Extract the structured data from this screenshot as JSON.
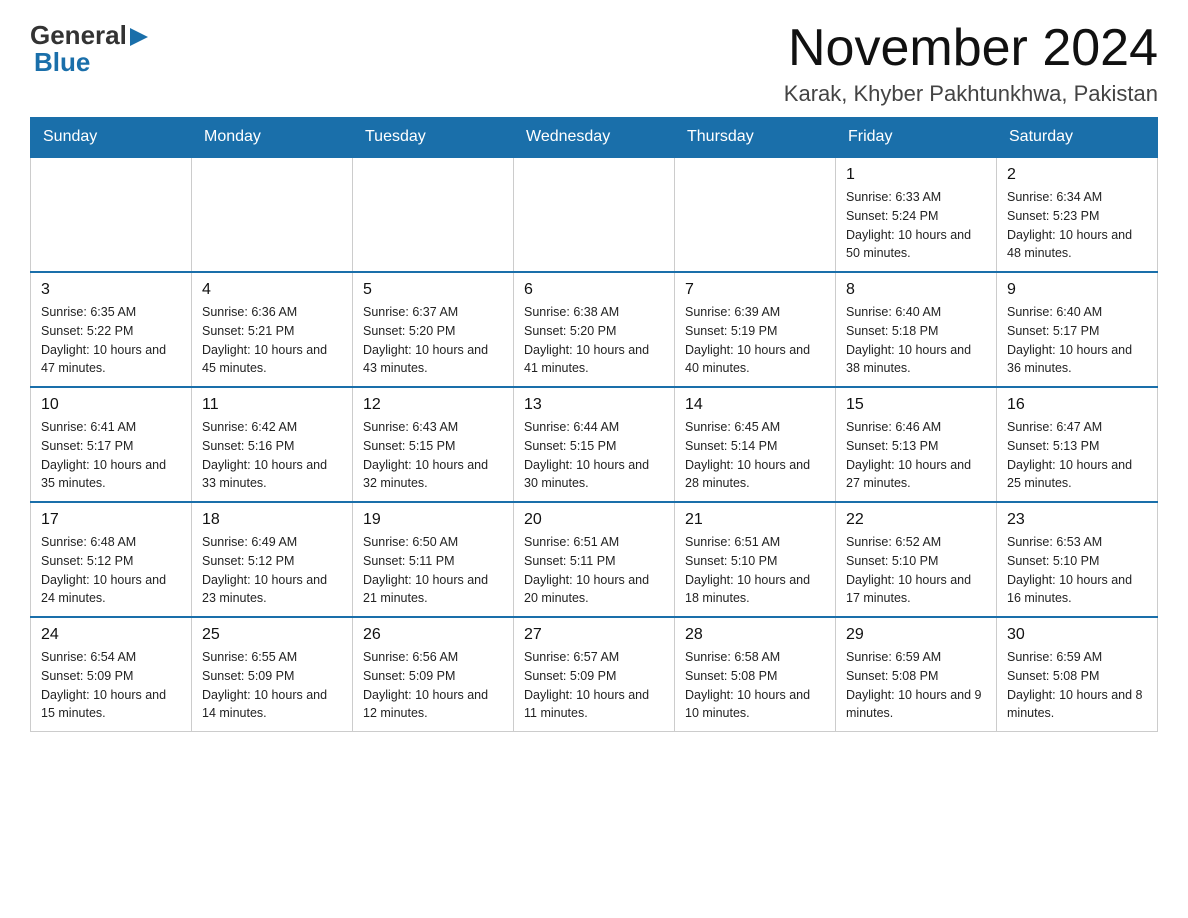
{
  "header": {
    "logo": {
      "general": "General",
      "blue": "Blue"
    },
    "title": "November 2024",
    "subtitle": "Karak, Khyber Pakhtunkhwa, Pakistan"
  },
  "calendar": {
    "headers": [
      "Sunday",
      "Monday",
      "Tuesday",
      "Wednesday",
      "Thursday",
      "Friday",
      "Saturday"
    ],
    "weeks": [
      [
        {
          "day": "",
          "info": ""
        },
        {
          "day": "",
          "info": ""
        },
        {
          "day": "",
          "info": ""
        },
        {
          "day": "",
          "info": ""
        },
        {
          "day": "",
          "info": ""
        },
        {
          "day": "1",
          "info": "Sunrise: 6:33 AM\nSunset: 5:24 PM\nDaylight: 10 hours and 50 minutes."
        },
        {
          "day": "2",
          "info": "Sunrise: 6:34 AM\nSunset: 5:23 PM\nDaylight: 10 hours and 48 minutes."
        }
      ],
      [
        {
          "day": "3",
          "info": "Sunrise: 6:35 AM\nSunset: 5:22 PM\nDaylight: 10 hours and 47 minutes."
        },
        {
          "day": "4",
          "info": "Sunrise: 6:36 AM\nSunset: 5:21 PM\nDaylight: 10 hours and 45 minutes."
        },
        {
          "day": "5",
          "info": "Sunrise: 6:37 AM\nSunset: 5:20 PM\nDaylight: 10 hours and 43 minutes."
        },
        {
          "day": "6",
          "info": "Sunrise: 6:38 AM\nSunset: 5:20 PM\nDaylight: 10 hours and 41 minutes."
        },
        {
          "day": "7",
          "info": "Sunrise: 6:39 AM\nSunset: 5:19 PM\nDaylight: 10 hours and 40 minutes."
        },
        {
          "day": "8",
          "info": "Sunrise: 6:40 AM\nSunset: 5:18 PM\nDaylight: 10 hours and 38 minutes."
        },
        {
          "day": "9",
          "info": "Sunrise: 6:40 AM\nSunset: 5:17 PM\nDaylight: 10 hours and 36 minutes."
        }
      ],
      [
        {
          "day": "10",
          "info": "Sunrise: 6:41 AM\nSunset: 5:17 PM\nDaylight: 10 hours and 35 minutes."
        },
        {
          "day": "11",
          "info": "Sunrise: 6:42 AM\nSunset: 5:16 PM\nDaylight: 10 hours and 33 minutes."
        },
        {
          "day": "12",
          "info": "Sunrise: 6:43 AM\nSunset: 5:15 PM\nDaylight: 10 hours and 32 minutes."
        },
        {
          "day": "13",
          "info": "Sunrise: 6:44 AM\nSunset: 5:15 PM\nDaylight: 10 hours and 30 minutes."
        },
        {
          "day": "14",
          "info": "Sunrise: 6:45 AM\nSunset: 5:14 PM\nDaylight: 10 hours and 28 minutes."
        },
        {
          "day": "15",
          "info": "Sunrise: 6:46 AM\nSunset: 5:13 PM\nDaylight: 10 hours and 27 minutes."
        },
        {
          "day": "16",
          "info": "Sunrise: 6:47 AM\nSunset: 5:13 PM\nDaylight: 10 hours and 25 minutes."
        }
      ],
      [
        {
          "day": "17",
          "info": "Sunrise: 6:48 AM\nSunset: 5:12 PM\nDaylight: 10 hours and 24 minutes."
        },
        {
          "day": "18",
          "info": "Sunrise: 6:49 AM\nSunset: 5:12 PM\nDaylight: 10 hours and 23 minutes."
        },
        {
          "day": "19",
          "info": "Sunrise: 6:50 AM\nSunset: 5:11 PM\nDaylight: 10 hours and 21 minutes."
        },
        {
          "day": "20",
          "info": "Sunrise: 6:51 AM\nSunset: 5:11 PM\nDaylight: 10 hours and 20 minutes."
        },
        {
          "day": "21",
          "info": "Sunrise: 6:51 AM\nSunset: 5:10 PM\nDaylight: 10 hours and 18 minutes."
        },
        {
          "day": "22",
          "info": "Sunrise: 6:52 AM\nSunset: 5:10 PM\nDaylight: 10 hours and 17 minutes."
        },
        {
          "day": "23",
          "info": "Sunrise: 6:53 AM\nSunset: 5:10 PM\nDaylight: 10 hours and 16 minutes."
        }
      ],
      [
        {
          "day": "24",
          "info": "Sunrise: 6:54 AM\nSunset: 5:09 PM\nDaylight: 10 hours and 15 minutes."
        },
        {
          "day": "25",
          "info": "Sunrise: 6:55 AM\nSunset: 5:09 PM\nDaylight: 10 hours and 14 minutes."
        },
        {
          "day": "26",
          "info": "Sunrise: 6:56 AM\nSunset: 5:09 PM\nDaylight: 10 hours and 12 minutes."
        },
        {
          "day": "27",
          "info": "Sunrise: 6:57 AM\nSunset: 5:09 PM\nDaylight: 10 hours and 11 minutes."
        },
        {
          "day": "28",
          "info": "Sunrise: 6:58 AM\nSunset: 5:08 PM\nDaylight: 10 hours and 10 minutes."
        },
        {
          "day": "29",
          "info": "Sunrise: 6:59 AM\nSunset: 5:08 PM\nDaylight: 10 hours and 9 minutes."
        },
        {
          "day": "30",
          "info": "Sunrise: 6:59 AM\nSunset: 5:08 PM\nDaylight: 10 hours and 8 minutes."
        }
      ]
    ]
  }
}
